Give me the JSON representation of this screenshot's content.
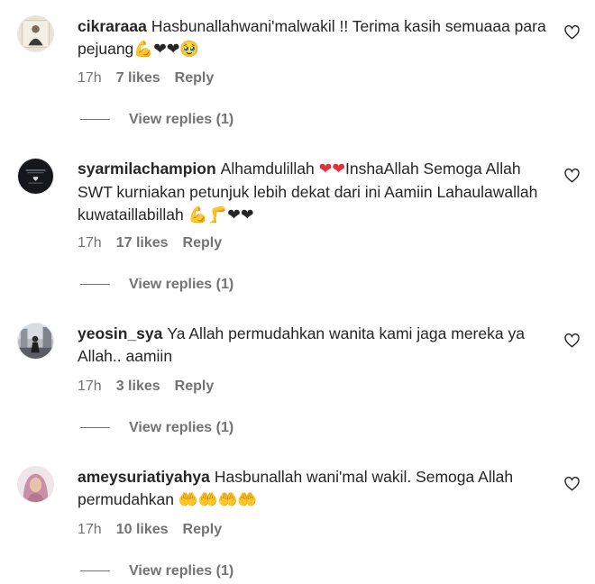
{
  "comments": [
    {
      "username": "cikraraaa",
      "text": "Hasbunallahwani'malwakil !! Terima kasih semuaaa para pejuang",
      "emoji": "💪❤❤🥹",
      "time": "17h",
      "likes": "7 likes",
      "reply_label": "Reply",
      "view_replies": "View replies (1)",
      "avatar_icon": "profile-photo-icon"
    },
    {
      "username": "syarmilachampion",
      "text": "Alhamdulillah",
      "emoji_mid": "❤❤",
      "text2": "InshaAllah Semoga Allah SWT kurniakan petunjuk lebih dekat dari ini Aamiin Lahaulawallah kuwataillabillah",
      "emoji": "💪🦵❤❤",
      "time": "17h",
      "likes": "17 likes",
      "reply_label": "Reply",
      "view_replies": "View replies (1)",
      "avatar_icon": "dark-logo-avatar-icon"
    },
    {
      "username": "yeosin_sya",
      "text": "Ya Allah permudahkan wanita kami jaga mereka ya Allah.. aamiin",
      "time": "17h",
      "likes": "3 likes",
      "reply_label": "Reply",
      "view_replies": "View replies (1)",
      "avatar_icon": "street-photo-avatar-icon"
    },
    {
      "username": "ameysuriatiyahya",
      "text": "Hasbunallah wani'mal wakil. Semoga Allah permudahkan",
      "emoji": "🤲🤲🤲🤲",
      "time": "17h",
      "likes": "10 likes",
      "reply_label": "Reply",
      "view_replies": "View replies (1)",
      "avatar_icon": "hijab-avatar-icon"
    }
  ],
  "colors": {
    "text": "#262626",
    "secondary": "#737373",
    "heart_outline": "#262626"
  },
  "icons": {
    "like": "heart-outline-icon"
  }
}
